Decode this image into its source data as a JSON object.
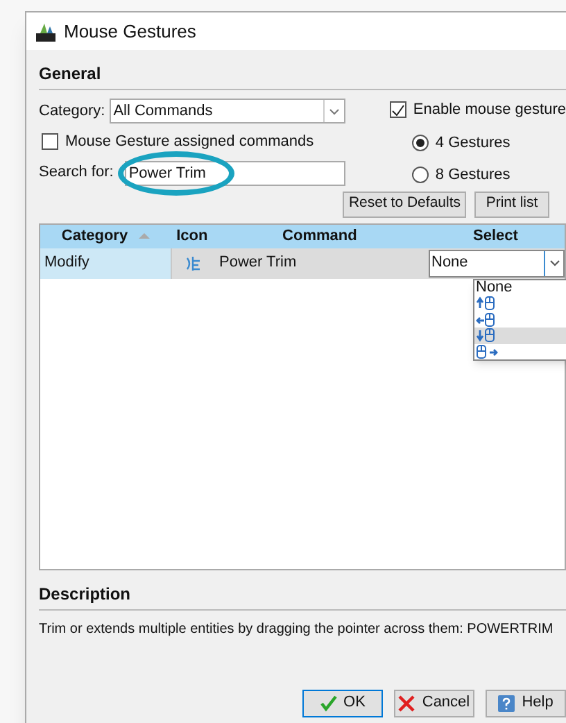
{
  "window": {
    "title": "Mouse Gestures"
  },
  "general": {
    "heading": "General",
    "category_label": "Category:",
    "category_value": "All Commands",
    "assigned_only": {
      "label": "Mouse Gesture assigned commands",
      "checked": false
    },
    "search_label": "Search for:",
    "search_value": "Power Trim",
    "enable": {
      "label": "Enable mouse gesture",
      "checked": true
    },
    "gesture_modes": [
      {
        "label": "4 Gestures",
        "selected": true
      },
      {
        "label": "8 Gestures",
        "selected": false
      }
    ],
    "buttons": [
      "Reset to Defaults",
      "Print list"
    ]
  },
  "table": {
    "columns": [
      "Category",
      "Icon",
      "Command",
      "Select"
    ],
    "rows": [
      {
        "category": "Modify",
        "command": "Power Trim",
        "select": "None",
        "selected": true
      }
    ],
    "dropdown": [
      {
        "kind": "text",
        "label": "None",
        "selected": false
      },
      {
        "kind": "up",
        "selected": false
      },
      {
        "kind": "left",
        "selected": false
      },
      {
        "kind": "down",
        "selected": true
      },
      {
        "kind": "right",
        "selected": false
      }
    ]
  },
  "description": {
    "heading": "Description",
    "text": "Trim or extends multiple entities by dragging the pointer across them: POWERTRIM"
  },
  "footer_buttons": [
    {
      "kind": "ok",
      "label": "OK"
    },
    {
      "kind": "cancel",
      "label": "Cancel"
    },
    {
      "kind": "help",
      "label": "Help"
    }
  ]
}
